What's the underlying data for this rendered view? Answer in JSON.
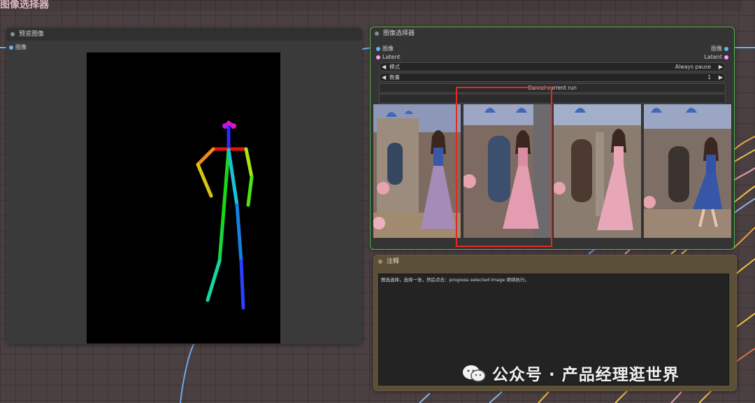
{
  "page_title": "图像选择器",
  "preview_node": {
    "title": "预览图像",
    "input_socket_label": "图像"
  },
  "chooser_node": {
    "title": "图像选择器",
    "inputs": [
      "图像",
      "Latent"
    ],
    "outputs": [
      "图像",
      "Latent"
    ],
    "mode": {
      "label": "模式",
      "value": "Always pause"
    },
    "count": {
      "label": "数量",
      "value": "1"
    },
    "cancel_button_label": "Cancel current run",
    "gallery_count": 4,
    "selected_index": 1
  },
  "note_node": {
    "title": "注释",
    "text": "图选选择，选择一张，然后点击：progress selected image 继续执行。"
  },
  "watermark": {
    "text": "公众号 · 产品经理逛世界"
  },
  "colors": {
    "accent_green": "#4fb84f",
    "selection_red": "#e02b23",
    "image_socket": "#64b5f6",
    "latent_socket": "#ff9cf9",
    "note_bg": "#5b4f38"
  }
}
